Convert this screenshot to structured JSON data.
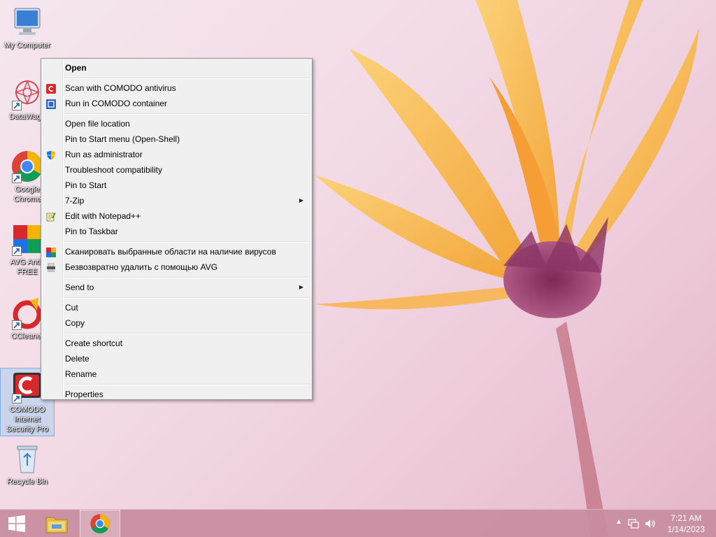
{
  "desktop": {
    "icons": [
      {
        "label": "My Computer",
        "icon": "computer-icon"
      },
      {
        "label": "DataWago",
        "icon": "datawago-icon"
      },
      {
        "label": "Google Chrome",
        "icon": "chrome-icon"
      },
      {
        "label": "AVG Antiv FREE",
        "icon": "avg-icon"
      },
      {
        "label": "CCleaner",
        "icon": "ccleaner-icon"
      },
      {
        "label": "COMODO Internet Security Pro",
        "icon": "comodo-icon"
      },
      {
        "label": "Recycle Bin",
        "icon": "recycle-bin-icon"
      }
    ]
  },
  "context_menu": {
    "items": [
      {
        "label": "Open"
      },
      {
        "label": "Scan with COMODO antivirus"
      },
      {
        "label": "Run in COMODO container"
      },
      {
        "label": "Open file location"
      },
      {
        "label": "Pin to Start menu (Open-Shell)"
      },
      {
        "label": "Run as administrator"
      },
      {
        "label": "Troubleshoot compatibility"
      },
      {
        "label": "Pin to Start"
      },
      {
        "label": "7-Zip"
      },
      {
        "label": "Edit with Notepad++"
      },
      {
        "label": "Pin to Taskbar"
      },
      {
        "label": "Сканировать выбранные области на наличие вирусов"
      },
      {
        "label": "Безвозвратно удалить с помощью AVG"
      },
      {
        "label": "Send to"
      },
      {
        "label": "Cut"
      },
      {
        "label": "Copy"
      },
      {
        "label": "Create shortcut"
      },
      {
        "label": "Delete"
      },
      {
        "label": "Rename"
      },
      {
        "label": "Properties"
      }
    ],
    "submenu_arrow": "▶"
  },
  "taskbar": {
    "clock_time": "7:21 AM",
    "clock_date": "1/14/2023",
    "tray_arrow": "▲"
  },
  "colors": {
    "comodo_red": "#d9282b",
    "menu_bg": "#f0f0f0",
    "taskbar": "#c88ca0"
  }
}
